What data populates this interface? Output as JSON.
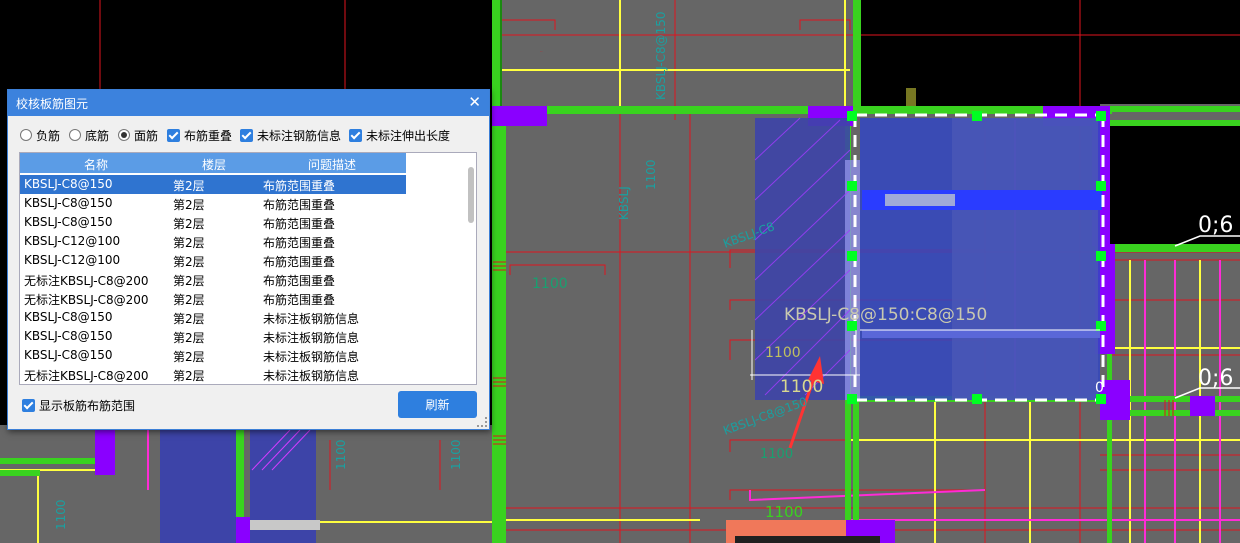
{
  "dialog": {
    "title": "校核板筋图元",
    "close_icon": "close-icon",
    "options": [
      {
        "type": "radio",
        "label": "负筋",
        "checked": false
      },
      {
        "type": "radio",
        "label": "底筋",
        "checked": false
      },
      {
        "type": "radio",
        "label": "面筋",
        "checked": true
      },
      {
        "type": "checkbox",
        "label": "布筋重叠",
        "checked": true
      },
      {
        "type": "checkbox",
        "label": "未标注钢筋信息",
        "checked": true
      },
      {
        "type": "checkbox",
        "label": "未标注伸出长度",
        "checked": true
      }
    ],
    "table": {
      "headers": [
        "名称",
        "楼层",
        "问题描述"
      ],
      "rows": [
        [
          "KBSLJ-C8@150",
          "第2层",
          "布筋范围重叠"
        ],
        [
          "KBSLJ-C8@150",
          "第2层",
          "布筋范围重叠"
        ],
        [
          "KBSLJ-C8@150",
          "第2层",
          "布筋范围重叠"
        ],
        [
          "KBSLJ-C12@100",
          "第2层",
          "布筋范围重叠"
        ],
        [
          "KBSLJ-C12@100",
          "第2层",
          "布筋范围重叠"
        ],
        [
          "无标注KBSLJ-C8@200",
          "第2层",
          "布筋范围重叠"
        ],
        [
          "无标注KBSLJ-C8@200",
          "第2层",
          "布筋范围重叠"
        ],
        [
          "KBSLJ-C8@150",
          "第2层",
          "未标注板钢筋信息"
        ],
        [
          "KBSLJ-C8@150",
          "第2层",
          "未标注板钢筋信息"
        ],
        [
          "KBSLJ-C8@150",
          "第2层",
          "未标注板钢筋信息"
        ],
        [
          "无标注KBSLJ-C8@200",
          "第2层",
          "未标注板钢筋信息"
        ]
      ],
      "selected_index": 0
    },
    "show_range_label": "显示板筋布筋范围",
    "show_range_checked": true,
    "refresh_label": "刷新"
  },
  "canvas": {
    "background": "#000000",
    "slab_color": "#666666",
    "beam_color": "#39d21f",
    "column_color": "#8a00ff",
    "axis_color": "#e0141e",
    "rebar_color": "#ffff40",
    "highlight_color": "#2e3fc8",
    "labels": {
      "main": "KBSLJ-C8@150:C8@150",
      "dim1": "1100",
      "dim2": "1100",
      "dim3": "1100",
      "dim4": "1100",
      "dim5": "1100",
      "dim6": "1100",
      "side1": "0;6",
      "side2": "0;6",
      "zero": "0"
    }
  }
}
